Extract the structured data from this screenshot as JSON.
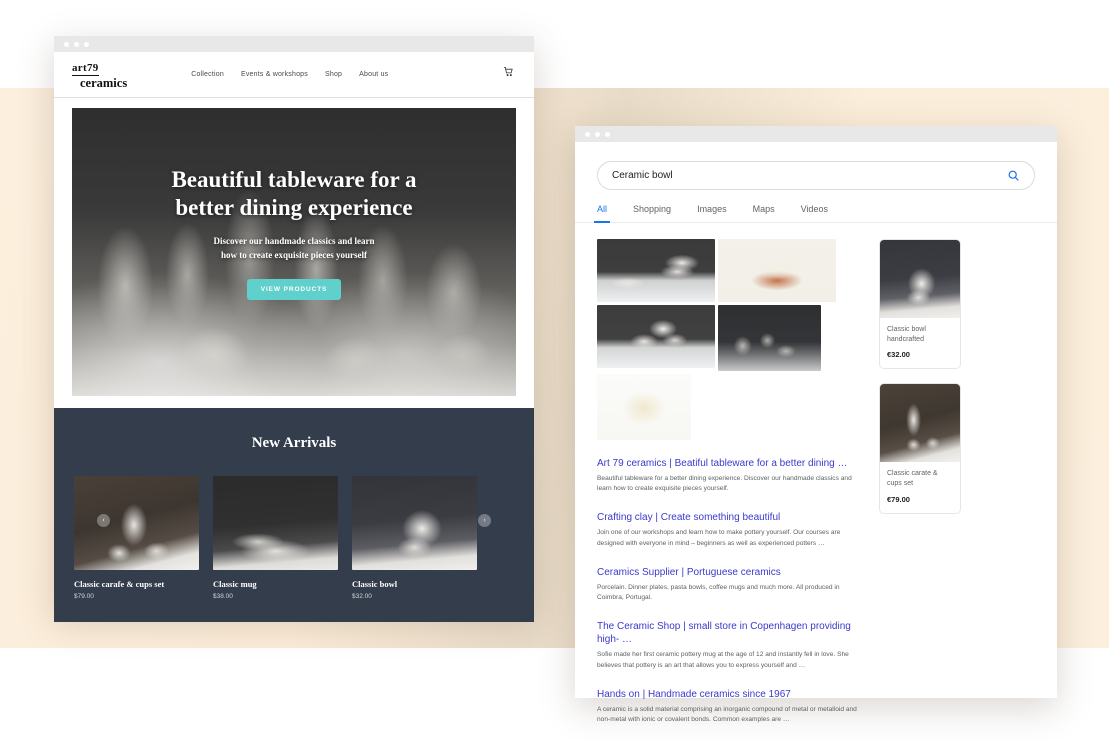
{
  "background": {
    "base_color": "#ffffff",
    "band_color": "#fcefdd"
  },
  "shop_window": {
    "name": "art79-ceramics-website",
    "chrome_dots": [
      "dot-1",
      "dot-2",
      "dot-3"
    ],
    "logo": {
      "line1": "art79",
      "line2": "ceramics"
    },
    "nav": [
      {
        "label": "Collection"
      },
      {
        "label": "Events & workshops"
      },
      {
        "label": "Shop"
      },
      {
        "label": "About us"
      }
    ],
    "cart_icon": "shopping-cart-icon",
    "hero": {
      "heading_line1": "Beautiful tableware for a",
      "heading_line2": "better dining experience",
      "sub_line1": "Discover our handmade classics and learn",
      "sub_line2": "how to create exquisite pieces yourself",
      "button_label": "VIEW PRODUCTS",
      "button_color": "#5fd0cc"
    },
    "arrivals": {
      "heading": "New Arrivals",
      "section_color": "#333d4b",
      "prev_icon": "chevron-left-icon",
      "next_icon": "chevron-right-icon",
      "products": [
        {
          "title": "Classic carafe & cups set",
          "price": "$79.00"
        },
        {
          "title": "Classic mug",
          "price": "$38.00"
        },
        {
          "title": "Classic bowl",
          "price": "$32.00"
        }
      ]
    }
  },
  "search_window": {
    "name": "search-engine-results",
    "chrome_dots": [
      "dot-1",
      "dot-2",
      "dot-3"
    ],
    "search": {
      "value": "Ceramic bowl",
      "placeholder": "Search",
      "icon": "search-icon",
      "accent_color": "#1a73e8"
    },
    "tabs": [
      {
        "label": "All",
        "active": true
      },
      {
        "label": "Shopping",
        "active": false
      },
      {
        "label": "Images",
        "active": false
      },
      {
        "label": "Maps",
        "active": false
      },
      {
        "label": "Videos",
        "active": false
      }
    ],
    "image_results": [
      {
        "name": "ceramic-plates-stack"
      },
      {
        "name": "terracotta-bowl-leaf-pattern"
      },
      {
        "name": "stacked-white-bowls"
      },
      {
        "name": "grey-pedestal-bowls"
      },
      {
        "name": "cream-round-bowl"
      }
    ],
    "results": [
      {
        "title": "Art 79 ceramics | Beatiful tableware for a better dining …",
        "snippet": "Beautiful tableware for a better dining experience. Discover our handmade classics and learn how to create exquisite pieces yourself."
      },
      {
        "title": "Crafting clay | Create something beautiful",
        "snippet": "Join one of our workshops and learn how to make pottery yourself. Our courses are designed with everyone in mind – beginners as well as experienced potters …"
      },
      {
        "title": "Ceramics Supplier | Portuguese ceramics",
        "snippet": "Porcelain. Dinner plates, pasta bowls, coffee mugs and much more. All produced in Coimbra, Portugal."
      },
      {
        "title": "The Ceramic Shop | small store in Copenhagen providing high- …",
        "snippet": "Sofie made her first ceramic pottery mug at the age of 12 and instantly fell in love. She believes that pottery is an art that allows you to express yourself and …"
      },
      {
        "title": "Hands on | Handmade ceramics since 1967",
        "snippet": "A ceramic is a solid material comprising an inorganic compound of metal or metalloid and non-metal with ionic or covalent bonds. Common examples are …"
      }
    ],
    "shopping_cards": [
      {
        "name": "Classic bowl handcrafted",
        "price": "€32.00"
      },
      {
        "name": "Classic carate & cups set",
        "price": "€79.00"
      }
    ]
  }
}
